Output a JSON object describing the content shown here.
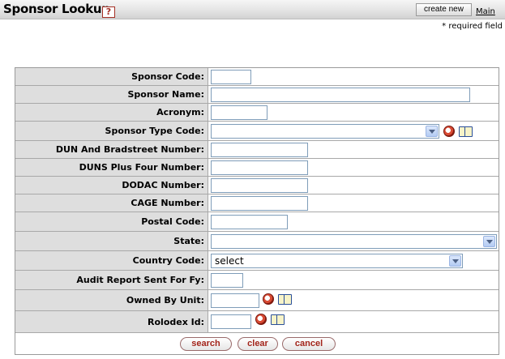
{
  "header": {
    "title": "Sponsor Lookup",
    "help_glyph": "?",
    "create_new_label": "create new",
    "main_link_label": "Main"
  },
  "required_note": "* required field",
  "fields": {
    "sponsor_code": {
      "label": "Sponsor Code:",
      "value": ""
    },
    "sponsor_name": {
      "label": "Sponsor Name:",
      "value": ""
    },
    "acronym": {
      "label": "Acronym:",
      "value": ""
    },
    "sponsor_type_code": {
      "label": "Sponsor Type Code:",
      "value": ""
    },
    "dun_bradstreet": {
      "label": "DUN And Bradstreet Number:",
      "value": ""
    },
    "duns_plus_four": {
      "label": "DUNS Plus Four Number:",
      "value": ""
    },
    "dodac": {
      "label": "DODAC Number:",
      "value": ""
    },
    "cage": {
      "label": "CAGE Number:",
      "value": ""
    },
    "postal_code": {
      "label": "Postal Code:",
      "value": ""
    },
    "state": {
      "label": "State:",
      "value": ""
    },
    "country_code": {
      "label": "Country Code:",
      "value": "select"
    },
    "audit_report": {
      "label": "Audit Report Sent For Fy:",
      "value": ""
    },
    "owned_by_unit": {
      "label": "Owned By Unit:",
      "value": ""
    },
    "rolodex_id": {
      "label": "Rolodex Id:",
      "value": ""
    }
  },
  "buttons": {
    "search": "search",
    "clear": "clear",
    "cancel": "cancel"
  },
  "icons": {
    "help": "help-icon",
    "lookup": "search-icon",
    "inquiry": "book-icon"
  },
  "colors": {
    "label_bg": "#dedede",
    "button_text": "#a3251b",
    "border": "#a8a8a8"
  }
}
